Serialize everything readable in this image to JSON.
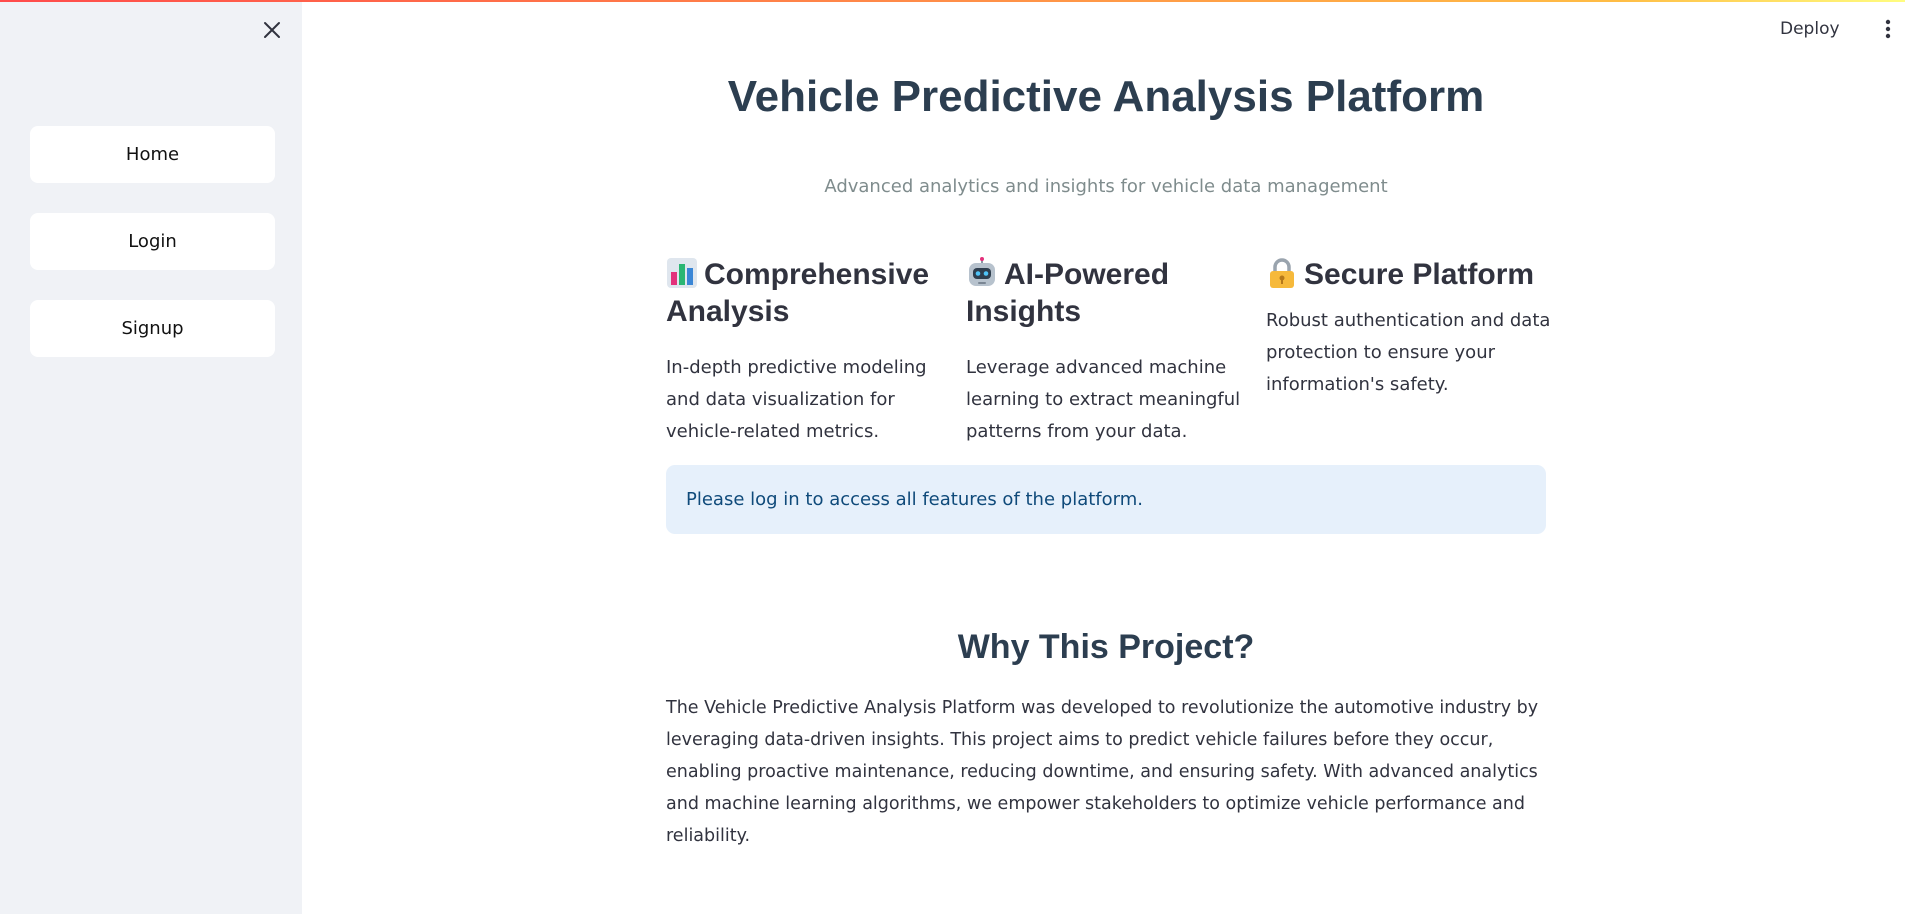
{
  "sidebar": {
    "close_icon": "close-icon",
    "items": [
      {
        "label": "Home"
      },
      {
        "label": "Login"
      },
      {
        "label": "Signup"
      }
    ]
  },
  "header": {
    "deploy_label": "Deploy",
    "menu_icon": "kebab-menu-icon"
  },
  "main": {
    "title": "Vehicle Predictive Analysis Platform",
    "subtitle": "Advanced analytics and insights for vehicle data management",
    "features": [
      {
        "icon": "bar-chart-icon",
        "title": "Comprehensive Analysis",
        "description": "In-depth predictive modeling and data visualization for vehicle-related metrics."
      },
      {
        "icon": "robot-icon",
        "title": "AI-Powered Insights",
        "description": "Leverage advanced machine learning to extract meaningful patterns from your data."
      },
      {
        "icon": "lock-icon",
        "title": "Secure Platform",
        "description": "Robust authentication and data protection to ensure your information's safety."
      }
    ],
    "info_message": "Please log in to access all features of the platform.",
    "why_title": "Why This Project?",
    "why_text": "The Vehicle Predictive Analysis Platform was developed to revolutionize the automotive industry by leveraging data-driven insights. This project aims to predict vehicle failures before they occur, enabling proactive maintenance, reducing downtime, and ensuring safety. With advanced analytics and machine learning algorithms, we empower stakeholders to optimize vehicle performance and reliability."
  },
  "colors": {
    "sidebar_bg": "#f0f2f6",
    "title": "#2c3e50",
    "subtitle": "#7f8c8d",
    "info_bg": "#e6f0fb",
    "info_text": "#0f4a7a"
  }
}
